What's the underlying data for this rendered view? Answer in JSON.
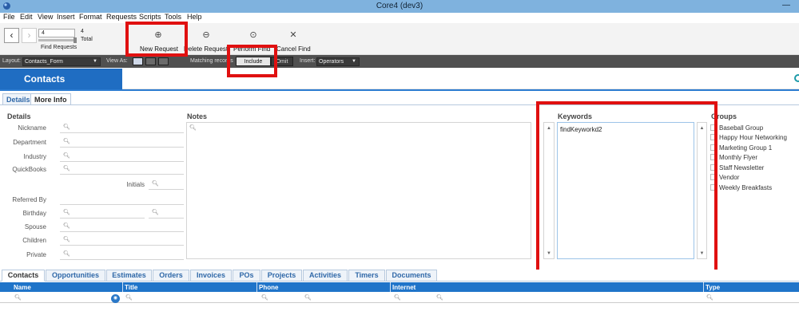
{
  "window": {
    "title": "Core4 (dev3)"
  },
  "menu": [
    "File",
    "Edit",
    "View",
    "Insert",
    "Format",
    "Requests",
    "Scripts",
    "Tools",
    "Help"
  ],
  "toolbar": {
    "record_value": "4",
    "total_count": "4",
    "total_label": "Total",
    "find_requests_label": "Find Requests",
    "new_request": "New Request",
    "delete_request": "Delete Request",
    "perform_find": "Perform Find",
    "cancel_find": "Cancel Find"
  },
  "layoutbar": {
    "layout_label": "Layout:",
    "layout_value": "Contacts_Form",
    "view_as_label": "View As:",
    "matching_label": "Matching records",
    "include": "Include",
    "omit": "Omit",
    "insert_label": "Insert:",
    "insert_value": "Operators"
  },
  "header": {
    "title": "Contacts"
  },
  "form_tabs": [
    "Details",
    "More Info"
  ],
  "details": {
    "title": "Details",
    "fields": [
      "Nickname",
      "Department",
      "Industry",
      "QuickBooks",
      "Initials",
      "Referred By",
      "Birthday",
      "Spouse",
      "Children",
      "Private"
    ]
  },
  "notes": {
    "title": "Notes"
  },
  "keywords": {
    "title": "Keywords",
    "value": "findKeyworkd2"
  },
  "groups": {
    "title": "Groups",
    "items": [
      "Baseball Group",
      "Happy Hour Networking",
      "Marketing Group 1",
      "Monthly Flyer",
      "Staff Newsletter",
      "Vendor",
      "Weekly Breakfasts"
    ]
  },
  "portal_tabs": [
    "Contacts",
    "Opportunities",
    "Estimates",
    "Orders",
    "Invoices",
    "POs",
    "Projects",
    "Activities",
    "Timers",
    "Documents"
  ],
  "columns": [
    "Name",
    "Title",
    "Phone",
    "Internet",
    "Type"
  ],
  "colors": {
    "accent_blue": "#1f6dc2",
    "highlight_red": "#e01010",
    "layout_bar": "#505050"
  }
}
